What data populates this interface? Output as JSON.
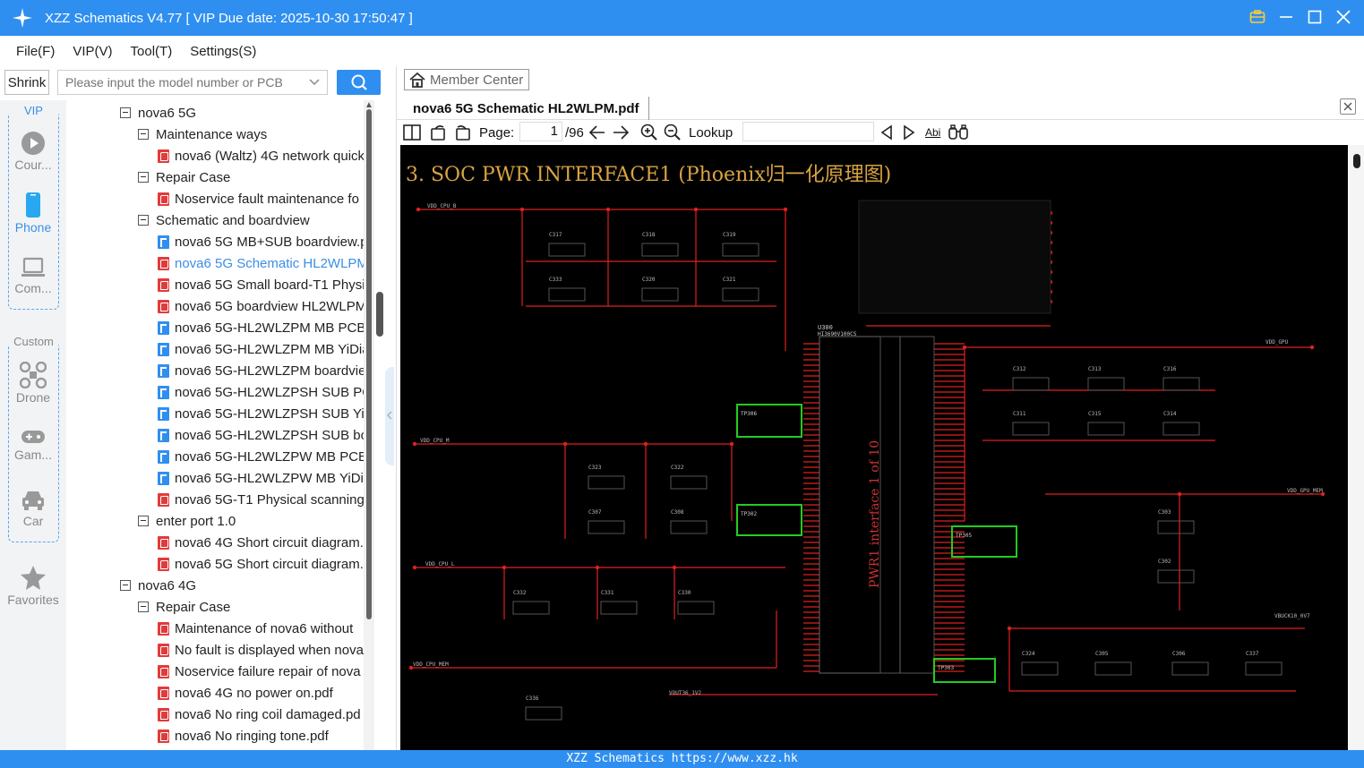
{
  "titlebar": {
    "title": "XZZ Schematics V4.77 [ VIP Due date: 2025-10-30 17:50:47 ]"
  },
  "menu": [
    "File(F)",
    "VIP(V)",
    "Tool(T)",
    "Settings(S)"
  ],
  "search": {
    "shrink_label": "Shrink",
    "placeholder": "Please input the model number or PCB"
  },
  "rail": {
    "vip_group": "VIP",
    "custom_group": "Custom",
    "items": [
      "Cour...",
      "Phone",
      "Com...",
      "Drone",
      "Gam...",
      "Car",
      "Favorites"
    ]
  },
  "tree": [
    {
      "label": "nova6 5G",
      "type": "folder",
      "level": 0
    },
    {
      "label": "Maintenance ways",
      "type": "folder",
      "level": 1
    },
    {
      "label": "nova6 (Waltz) 4G network quick",
      "type": "pdf",
      "level": 2
    },
    {
      "label": "Repair Case",
      "type": "folder",
      "level": 1
    },
    {
      "label": "Noservice fault maintenance fo",
      "type": "pdf",
      "level": 2
    },
    {
      "label": "Schematic and boardview",
      "type": "folder",
      "level": 1
    },
    {
      "label": "nova6 5G MB+SUB boardview.p",
      "type": "pcb",
      "level": 2
    },
    {
      "label": "nova6 5G Schematic HL2WLPM",
      "type": "pdf",
      "level": 2,
      "active": true
    },
    {
      "label": "nova6 5G Small board-T1 Physi",
      "type": "pdf",
      "level": 2
    },
    {
      "label": "nova6 5G boardview HL2WLPM",
      "type": "pdf",
      "level": 2
    },
    {
      "label": "nova6 5G-HL2WLZPM MB PCB",
      "type": "pcb",
      "level": 2
    },
    {
      "label": "nova6 5G-HL2WLZPM MB YiDia",
      "type": "pcb",
      "level": 2
    },
    {
      "label": "nova6 5G-HL2WLZPM boardvie",
      "type": "pcb",
      "level": 2
    },
    {
      "label": "nova6 5G-HL2WLZPSH SUB PCE",
      "type": "pcb",
      "level": 2
    },
    {
      "label": "nova6 5G-HL2WLZPSH SUB YiD",
      "type": "pcb",
      "level": 2
    },
    {
      "label": "nova6 5G-HL2WLZPSH SUB boa",
      "type": "pcb",
      "level": 2
    },
    {
      "label": "nova6 5G-HL2WLZPW MB PCB",
      "type": "pcb",
      "level": 2
    },
    {
      "label": "nova6 5G-HL2WLZPW MB YiDia",
      "type": "pcb",
      "level": 2
    },
    {
      "label": "nova6 5G-T1 Physical scanning",
      "type": "pdf",
      "level": 2
    },
    {
      "label": "enter port 1.0",
      "type": "folder",
      "level": 1
    },
    {
      "label": "nova6 4G Short circuit diagram.",
      "type": "pdf",
      "level": 2
    },
    {
      "label": "nova6 5G Short circuit diagram.",
      "type": "pdf",
      "level": 2
    },
    {
      "label": "nova6 4G",
      "type": "folder",
      "level": 0
    },
    {
      "label": "Repair Case",
      "type": "folder",
      "level": 1
    },
    {
      "label": "Maintenance of nova6 without",
      "type": "pdf",
      "level": 2
    },
    {
      "label": "No fault is displayed when nova",
      "type": "pdf",
      "level": 2
    },
    {
      "label": "Noservice failure repair of nova",
      "type": "pdf",
      "level": 2
    },
    {
      "label": "nova6 4G no power on.pdf",
      "type": "pdf",
      "level": 2
    },
    {
      "label": "nova6 No ring coil damaged.pd",
      "type": "pdf",
      "level": 2
    },
    {
      "label": "nova6 No ringing tone.pdf",
      "type": "pdf",
      "level": 2
    }
  ],
  "viewer": {
    "member_center": "Member Center",
    "tab_title": "nova6 5G Schematic HL2WLPM.pdf",
    "page_label": "Page:",
    "page_current": "1",
    "page_total": "/96",
    "lookup_label": "Lookup",
    "abi_label": "Abi"
  },
  "schematic": {
    "title": "3. SOC PWR INTERFACE1 (Phoenix归一化原理图)",
    "rails": [
      "VDD_CPU_B",
      "VDD_CPU_M",
      "VDD_CPU_L",
      "VDD_CPU_MEM",
      "VDD_GPU",
      "VDD_GPU_MEM",
      "VBUCK10_0V7",
      "VOUT36_1V2"
    ],
    "caps": [
      "C317",
      "C318",
      "C319",
      "C333",
      "C320",
      "C321",
      "C323",
      "C322",
      "C307",
      "C308",
      "C332",
      "C331",
      "C330",
      "C312",
      "C313",
      "C316",
      "C311",
      "C315",
      "C314",
      "C303",
      "C302",
      "C324",
      "C305",
      "C306",
      "C337",
      "C336"
    ],
    "testpoints": [
      "TP306",
      "TP307",
      "TP302",
      "TP301",
      "TP305",
      "TP304",
      "TP303"
    ],
    "ic": "U300",
    "ic_part": "HI3690V100CS",
    "ic_label": "PWR1 interface 1 of 10"
  },
  "statusbar": {
    "text": "XZZ Schematics https://www.xzz.hk"
  },
  "colors": {
    "accent": "#2f8ff0",
    "active_link": "#3a8ee6",
    "wire": "#e02020",
    "highlight": "#22cc22"
  }
}
